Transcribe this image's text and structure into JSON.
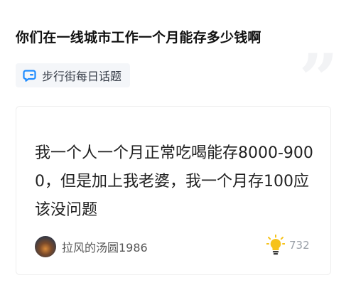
{
  "topic": {
    "title": "你们在一线城市工作一个月能存多少钱啊",
    "tag_icon": "message-bubble-icon",
    "tag_label": "步行街每日话题",
    "decoration_icon": "quote-mark-icon"
  },
  "reply": {
    "text": "我一个人一个月正常吃喝能存8000-9000，但是加上我老婆，我一个月存100应该没问题",
    "author": "拉风的汤圆1986",
    "avatar_icon": "avatar",
    "like_icon": "lightbulb-icon",
    "like_count": "732"
  },
  "colors": {
    "accent": "#1f8cff",
    "bulb": "#f6c21a",
    "text": "#222222",
    "muted": "#9aa0a8"
  }
}
